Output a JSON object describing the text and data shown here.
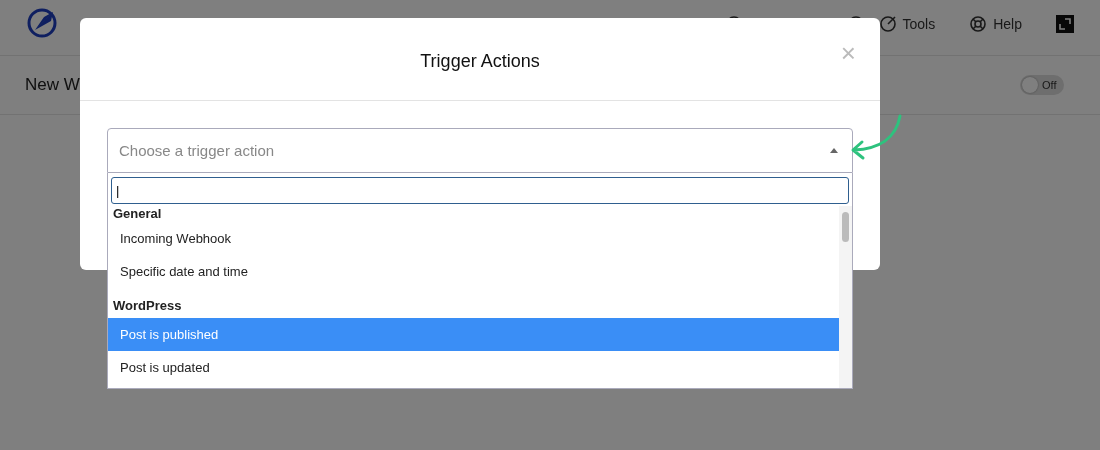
{
  "header": {
    "nav": [
      {
        "label": "Tools",
        "kind": "tools"
      },
      {
        "label": "Help",
        "kind": "help"
      }
    ]
  },
  "page": {
    "title": "New W",
    "toggle": {
      "on": false,
      "label": "Off"
    }
  },
  "modal": {
    "title": "Trigger Actions",
    "close": "×"
  },
  "select": {
    "placeholder": "Choose a trigger action",
    "expanded": true,
    "search": {
      "value": "|"
    },
    "groups": [
      {
        "label": "General",
        "options": [
          {
            "label": "Incoming Webhook",
            "selected": false
          },
          {
            "label": "Specific date and time",
            "selected": false
          }
        ]
      },
      {
        "label": "WordPress",
        "options": [
          {
            "label": "Post is published",
            "selected": true
          },
          {
            "label": "Post is updated",
            "selected": false
          }
        ]
      }
    ]
  }
}
